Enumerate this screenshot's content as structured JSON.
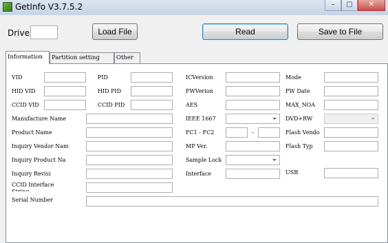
{
  "window": {
    "title": "GetInfo V3.7.5.2",
    "controls": {
      "minimize": "–",
      "maximize": "□",
      "close": "✕"
    }
  },
  "toolbar": {
    "drive_label": "Drive",
    "drive_value": "",
    "load_file": "Load File",
    "read": "Read",
    "save_to_file": "Save to File"
  },
  "tabs": [
    "Information",
    "Partition setting",
    "Other"
  ],
  "fields": {
    "vid": "VID",
    "pid": "PID",
    "ic_version": "ICVersion",
    "mode": "Mode",
    "hid_vid": "HID VID",
    "hid_pid": "HID PID",
    "fw_version": "FWVerion",
    "fw_date": "FW Date",
    "ccid_vid": "CCID VID",
    "ccid_pid": "CCID PID",
    "aes": "AES",
    "max_noa": "MAX_NOA",
    "manufacture_name": "Manufacture Name",
    "ieee_1667": "IEEE 1667",
    "dvd_rw": "DVD+RW",
    "product_name": "Product Name",
    "fc1_fc2": "FC1 - FC2",
    "fc_sep": "-",
    "flash_vendor": "Flash Vendo",
    "inquiry_vendor_name": "Inquiry Vendor Nam",
    "mp_ver": "MP Ver.",
    "flash_type": "Flash Typ",
    "inquiry_product_name": "Inquiry Product Na",
    "sample_lock": "Sample Lock",
    "inquiry_revision": "Inquiry Revisi",
    "interface": "Interface",
    "usb": "USB",
    "ccid_interface_string": "CCID Interface\nString",
    "serial_number": "Serial Number"
  }
}
